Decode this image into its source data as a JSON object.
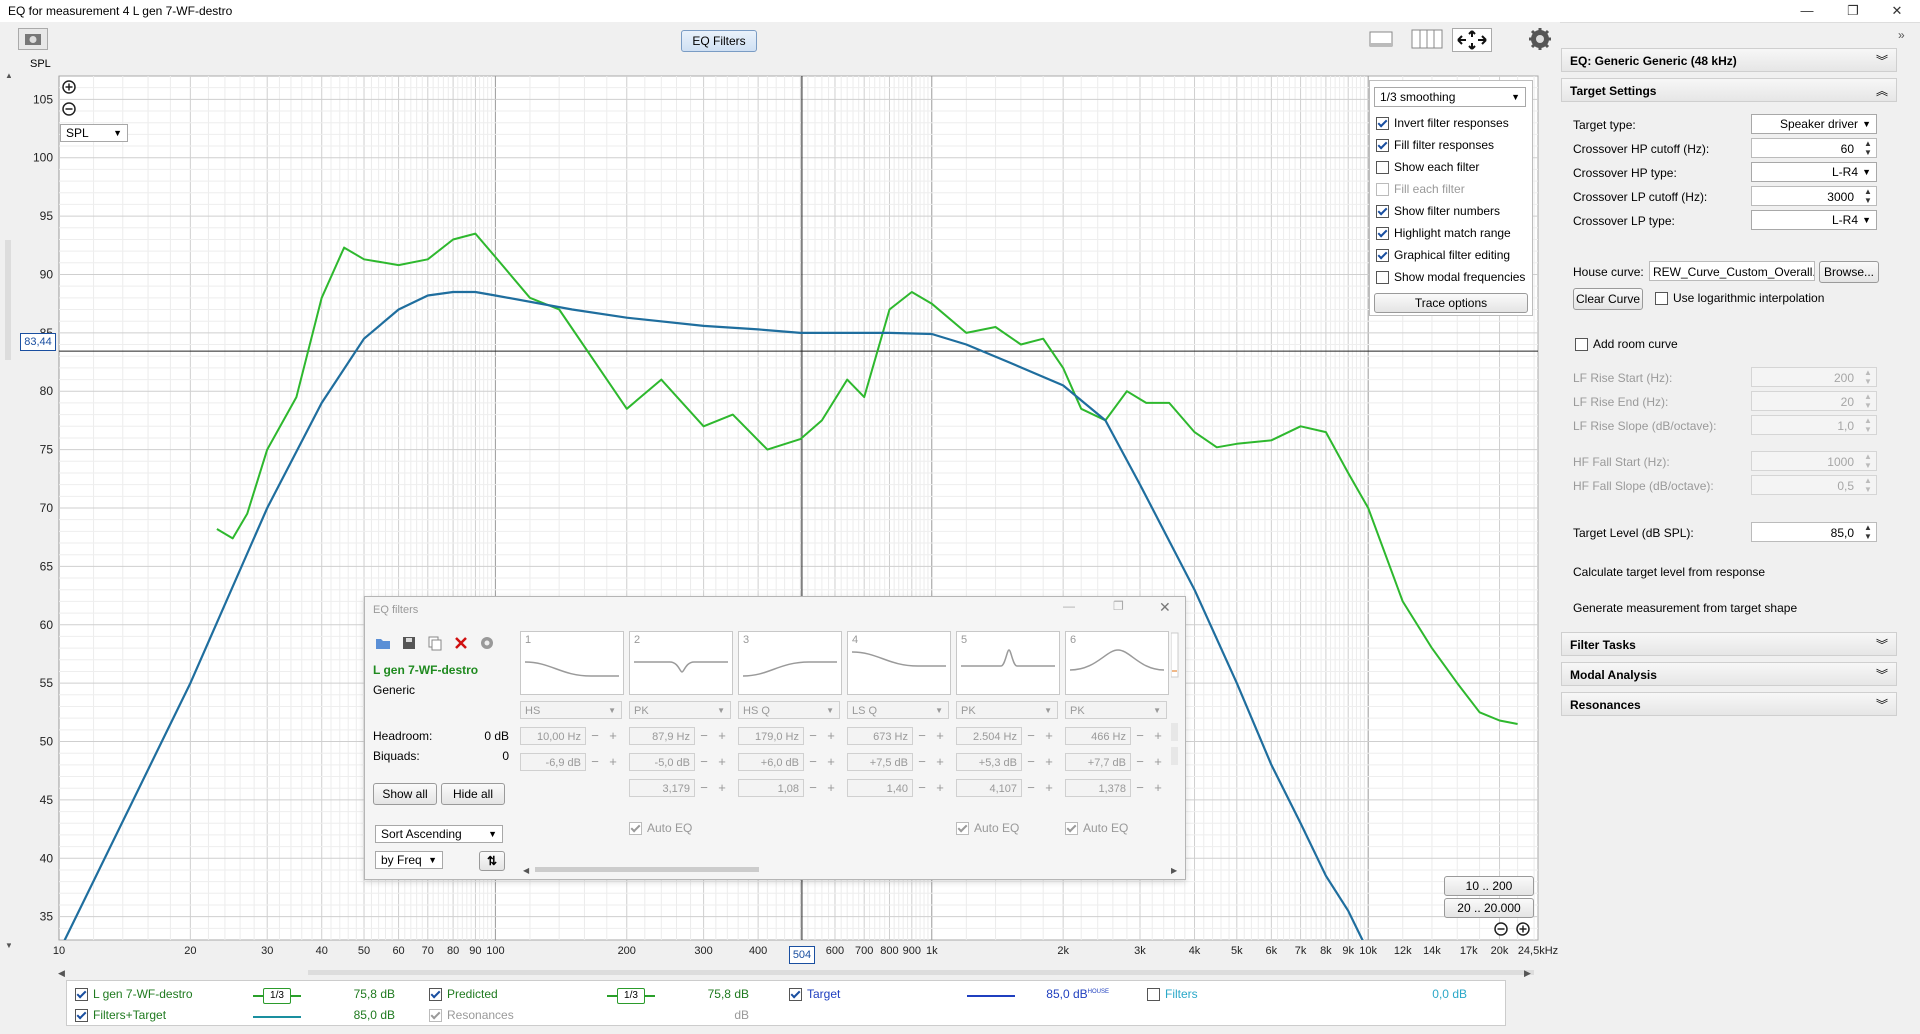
{
  "window": {
    "title": "EQ for measurement 4 L gen 7-WF-destro",
    "min": "—",
    "max": "❐",
    "close": "✕"
  },
  "toolbar": {
    "eq_filters_label": "EQ Filters"
  },
  "plot": {
    "y_unit": "SPL",
    "spl_select": "SPL",
    "cursor_value": "83,44",
    "cursor_freq": "504",
    "y_ticks": [
      "105",
      "100",
      "95",
      "90",
      "85",
      "80",
      "75",
      "70",
      "65",
      "60",
      "55",
      "50",
      "45",
      "40",
      "35"
    ],
    "x_ticks": [
      "10",
      "20",
      "30",
      "40",
      "50",
      "60",
      "70",
      "80",
      "90",
      "100",
      "200",
      "300",
      "400",
      "504",
      "600",
      "700",
      "800",
      "900",
      "1k",
      "2k",
      "3k",
      "4k",
      "5k",
      "6k",
      "7k",
      "8k",
      "9k",
      "10k",
      "12k",
      "14k",
      "17k",
      "20k",
      "24,5kHz"
    ],
    "range_btn_1": "10 .. 200",
    "range_btn_2": "20 .. 20.000"
  },
  "options": {
    "smoothing": "1/3 smoothing",
    "items": [
      {
        "label": "Invert filter responses",
        "checked": true,
        "disabled": false
      },
      {
        "label": "Fill filter responses",
        "checked": true,
        "disabled": false
      },
      {
        "label": "Show each filter",
        "checked": false,
        "disabled": false
      },
      {
        "label": "Fill each filter",
        "checked": false,
        "disabled": true
      },
      {
        "label": "Show filter numbers",
        "checked": true,
        "disabled": false
      },
      {
        "label": "Highlight match range",
        "checked": true,
        "disabled": false
      },
      {
        "label": "Graphical filter editing",
        "checked": true,
        "disabled": false
      },
      {
        "label": "Show modal frequencies",
        "checked": false,
        "disabled": false
      }
    ],
    "trace_options_label": "Trace options"
  },
  "eq_dialog": {
    "title": "EQ filters",
    "measurement": "L gen 7-WF-destro",
    "equaliser": "Generic",
    "headroom_label": "Headroom:",
    "headroom_value": "0 dB",
    "biquads_label": "Biquads:",
    "biquads_value": "0",
    "show_all": "Show all",
    "hide_all": "Hide all",
    "sort": "Sort Ascending",
    "by": "by Freq",
    "filters": [
      {
        "num": "1",
        "type": "HS",
        "freq": "10,00 Hz",
        "gain": "-6,9 dB",
        "q": "",
        "auto": ""
      },
      {
        "num": "2",
        "type": "PK",
        "freq": "87,9 Hz",
        "gain": "-5,0 dB",
        "q": "3,179",
        "auto": "Auto EQ"
      },
      {
        "num": "3",
        "type": "HS Q",
        "freq": "179,0 Hz",
        "gain": "+6,0 dB",
        "q": "1,08",
        "auto": ""
      },
      {
        "num": "4",
        "type": "LS Q",
        "freq": "673 Hz",
        "gain": "+7,5 dB",
        "q": "1,40",
        "auto": ""
      },
      {
        "num": "5",
        "type": "PK",
        "freq": "2.504 Hz",
        "gain": "+5,3 dB",
        "q": "4,107",
        "auto": "Auto EQ"
      },
      {
        "num": "6",
        "type": "PK",
        "freq": "466 Hz",
        "gain": "+7,7 dB",
        "q": "1,378",
        "auto": "Auto EQ"
      }
    ]
  },
  "right_panel": {
    "eq_header": "EQ: Generic Generic (48 kHz)",
    "target_header": "Target Settings",
    "target_type_label": "Target type:",
    "target_type_value": "Speaker driver",
    "hp_cutoff_label": "Crossover HP cutoff (Hz):",
    "hp_cutoff_value": "60",
    "hp_type_label": "Crossover HP type:",
    "hp_type_value": "L-R4",
    "lp_cutoff_label": "Crossover LP cutoff (Hz):",
    "lp_cutoff_value": "3000",
    "lp_type_label": "Crossover LP type:",
    "lp_type_value": "L-R4",
    "house_curve_label": "House curve:",
    "house_curve_value": "REW_Curve_Custom_Overall.txt",
    "browse_label": "Browse...",
    "clear_curve_label": "Clear Curve",
    "log_interp_label": "Use logarithmic interpolation",
    "room_curve_label": "Add room curve",
    "lf_rise_start_label": "LF Rise Start (Hz):",
    "lf_rise_start_value": "200",
    "lf_rise_end_label": "LF Rise End (Hz):",
    "lf_rise_end_value": "20",
    "lf_rise_slope_label": "LF Rise Slope (dB/octave):",
    "lf_rise_slope_value": "1,0",
    "hf_fall_start_label": "HF Fall Start (Hz):",
    "hf_fall_start_value": "1000",
    "hf_fall_slope_label": "HF Fall Slope (dB/octave):",
    "hf_fall_slope_value": "0,5",
    "target_level_label": "Target Level (dB SPL):",
    "target_level_value": "85,0",
    "calc_target_label": "Calculate target level from response",
    "gen_meas_label": "Generate measurement from target shape",
    "filter_tasks_header": "Filter Tasks",
    "modal_header": "Modal Analysis",
    "resonances_header": "Resonances"
  },
  "legend": {
    "items": [
      {
        "label": "L gen 7-WF-destro",
        "smooth": "1/3",
        "value": "75,8 dB",
        "color": "#2aa02a",
        "checked": true
      },
      {
        "label": "Predicted",
        "smooth": "1/3",
        "value": "75,8 dB",
        "color": "#2aa02a",
        "checked": true
      },
      {
        "label": "Target",
        "smooth": "",
        "value": "85,0 dB",
        "sup": "HOUSE",
        "color": "#1f3fbf",
        "checked": true
      },
      {
        "label": "Filters",
        "smooth": "",
        "value": "0,0 dB",
        "color": "#2aa8c8",
        "checked": false
      },
      {
        "label": "Filters+Target",
        "smooth": "",
        "value": "85,0 dB",
        "color": "#1a8f9f",
        "checked": true
      },
      {
        "label": "Resonances",
        "smooth": "",
        "value": "dB",
        "color": "#9a9a9a",
        "checked": true
      }
    ]
  },
  "colors": {
    "measurement": "#2eb82e",
    "target": "#1f6e9e",
    "accent": "#1a4fa0"
  },
  "chart_data": {
    "type": "line",
    "xscale": "log",
    "xlim": [
      10,
      24500
    ],
    "ylim": [
      33,
      107
    ],
    "series": [
      {
        "name": "L gen 7-WF-destro",
        "x": [
          23,
          25,
          27,
          30,
          35,
          40,
          45,
          50,
          60,
          70,
          80,
          90,
          100,
          120,
          140,
          200,
          240,
          300,
          350,
          420,
          500,
          560,
          640,
          700,
          800,
          900,
          1000,
          1200,
          1400,
          1600,
          1800,
          2000,
          2200,
          2500,
          2800,
          3100,
          3500,
          4000,
          4500,
          5000,
          6000,
          7000,
          8000,
          9000,
          10000,
          12000,
          14000,
          16000,
          18000,
          20000,
          22000
        ],
        "y": [
          68.2,
          67.4,
          69.5,
          75.0,
          79.5,
          88.0,
          92.3,
          91.3,
          90.8,
          91.3,
          93.0,
          93.5,
          91.5,
          88.0,
          87.0,
          78.5,
          81.0,
          77.0,
          78.0,
          75.0,
          75.9,
          77.5,
          81.0,
          79.5,
          87.0,
          88.5,
          87.5,
          85.0,
          85.5,
          84.0,
          84.5,
          82.0,
          78.5,
          77.5,
          80.0,
          79.0,
          79.0,
          76.5,
          75.2,
          75.5,
          75.8,
          77.0,
          76.5,
          73.0,
          70.0,
          62.0,
          58.0,
          55.0,
          52.5,
          51.8,
          51.5
        ]
      },
      {
        "name": "Target",
        "x": [
          10,
          20,
          30,
          40,
          50,
          60,
          70,
          80,
          90,
          100,
          150,
          200,
          300,
          400,
          500,
          600,
          700,
          800,
          1000,
          1200,
          1500,
          2000,
          2500,
          3000,
          4000,
          5000,
          6000,
          7000,
          8000,
          9000,
          10000,
          12000,
          14000
        ],
        "y": [
          32.0,
          55.0,
          70.0,
          79.0,
          84.5,
          87.0,
          88.2,
          88.5,
          88.5,
          88.2,
          87.0,
          86.3,
          85.6,
          85.3,
          85.0,
          85.0,
          85.0,
          85.0,
          84.9,
          84.0,
          82.5,
          80.5,
          77.5,
          72.0,
          63.0,
          55.0,
          48.0,
          43.0,
          38.5,
          35.5,
          32.0,
          28.0,
          25.0
        ]
      }
    ]
  }
}
